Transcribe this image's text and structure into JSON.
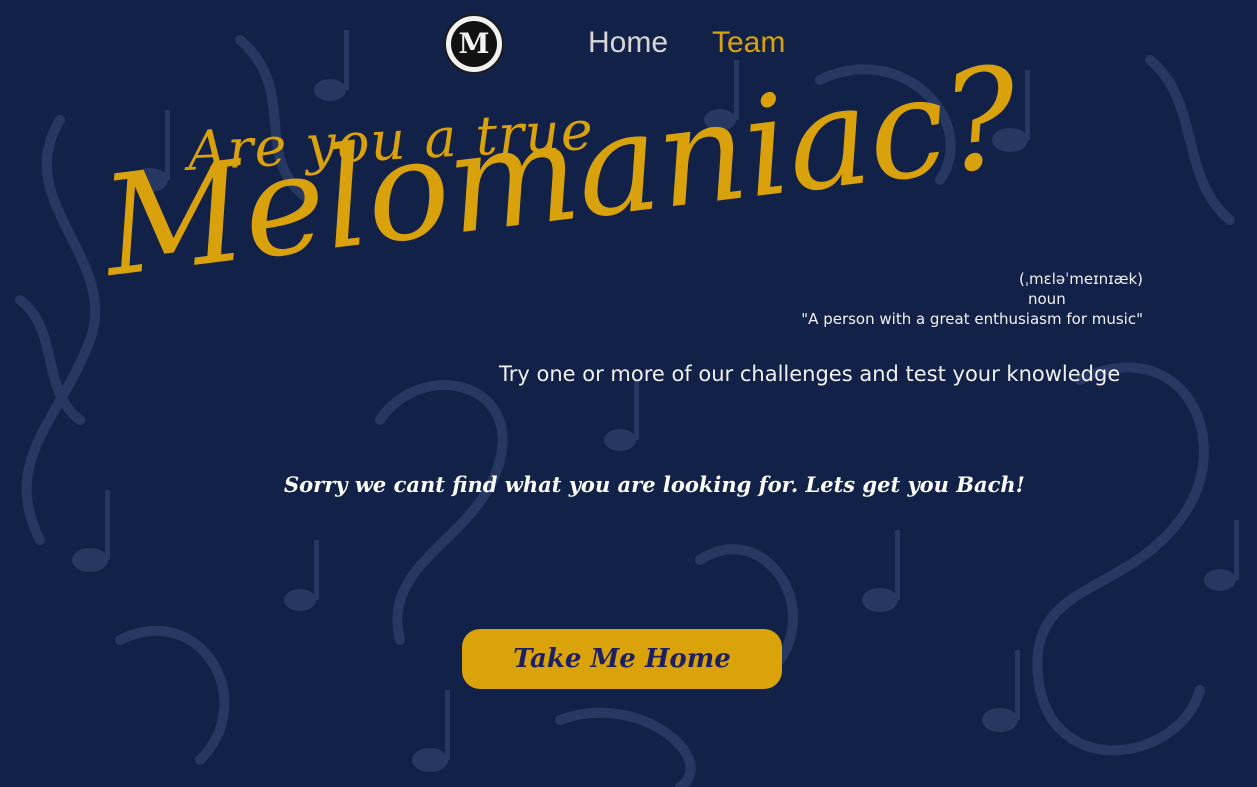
{
  "nav": {
    "logo_letter": "M",
    "home_label": "Home",
    "team_label": "Team",
    "active": "Team"
  },
  "hero": {
    "tagline_small": "Are you a true",
    "tagline_big": "Melomaniac?",
    "phonetic": "(ˌmɛləˈmeɪnɪæk)",
    "part_of_speech": "noun",
    "definition": "\"A person with a great enthusiasm for music\"",
    "subtitle": "Try one or more of our challenges and test your knowledge"
  },
  "error": {
    "message": "Sorry we cant find what you are looking for. Lets get you Bach!"
  },
  "cta": {
    "home_button_label": "Take Me Home"
  },
  "colors": {
    "background": "#122147",
    "accent_gold": "#d9a20d",
    "button_text": "#1c1f63",
    "nav_text": "#d7d7d7"
  }
}
